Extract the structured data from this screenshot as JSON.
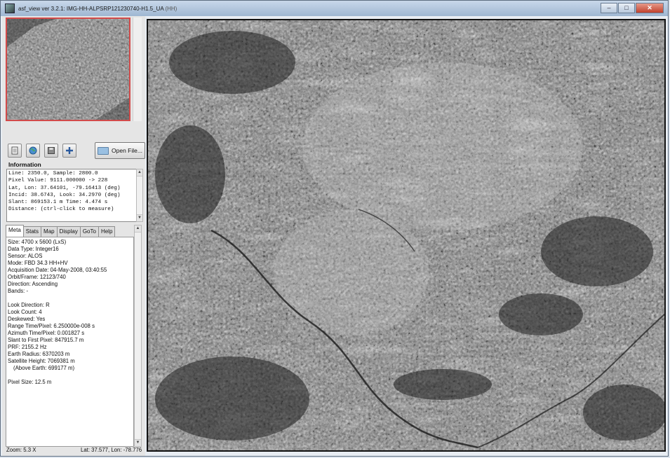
{
  "window": {
    "title": "asf_view ver 3.2.1: IMG-HH-ALPSRP121230740-H1.5_UA",
    "title_suffix": "(HH)",
    "controls": [
      "minimize",
      "maximize",
      "close"
    ]
  },
  "toolbar": {
    "icons": [
      "properties-icon",
      "globe-icon",
      "save-icon",
      "crosshair-icon"
    ],
    "open_file_label": "Open File..."
  },
  "information": {
    "label": "Information",
    "lines": [
      "Line: 2350.0, Sample: 2800.0",
      "Pixel Value: 9111.000000 -> 228",
      "Lat, Lon: 37.64101, -79.16413 (deg)",
      "Incid: 38.6743, Look: 34.2970 (deg)",
      "Slant: 869153.1 m Time: 4.474 s",
      "Distance: (ctrl-click to measure)"
    ]
  },
  "tabs": [
    "Meta",
    "Stats",
    "Map",
    "Display",
    "GoTo",
    "Help"
  ],
  "active_tab": "Meta",
  "meta": {
    "lines": [
      "Size: 4700 x 5600 (LxS)",
      "Data Type: Integer16",
      "Sensor: ALOS",
      "Mode: FBD 34.3 HH+HV",
      "Acquisition Date: 04-May-2008, 03:40:55",
      "Orbit/Frame: 12123/740",
      "Direction: Ascending",
      "Bands: -",
      "",
      "Look Direction: R",
      "Look Count: 4",
      "Deskewed: Yes",
      "Range Time/Pixel: 6.250000e-008 s",
      "Azimuth Time/Pixel: 0.001827 s",
      "Slant to First Pixel: 847915.7 m",
      "PRF: 2155.2 Hz",
      "Earth Radius: 6370203 m",
      "Satellite Height: 7069381 m",
      "(Above Earth: 699177 m)",
      "",
      "Pixel Size: 12.5 m"
    ]
  },
  "status": {
    "zoom": "Zoom: 5.3 X",
    "latlon": "Lat: 37.577, Lon: -78.776"
  },
  "colors": {
    "thumbnail_border": "#d24a4a",
    "titlebar": "#9fb7d2"
  }
}
